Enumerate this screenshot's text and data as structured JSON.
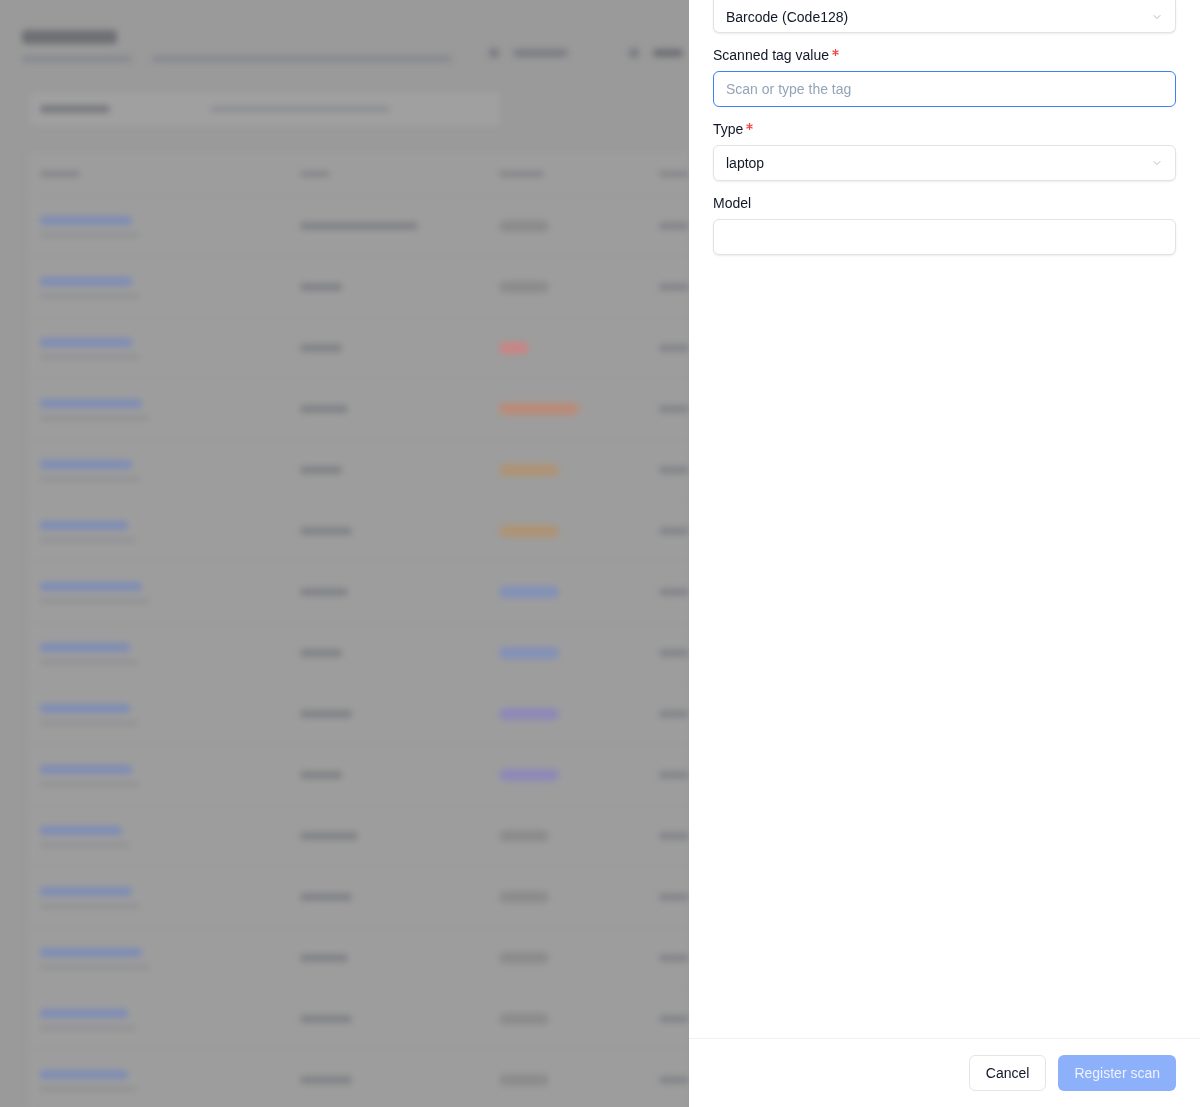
{
  "drawer": {
    "fields": [
      {
        "kind": "select",
        "value": "Barcode (Code128)"
      },
      {
        "kind": "input",
        "label": "Scanned tag value",
        "required": true,
        "placeholder": "Scan or type the tag",
        "focused": true
      },
      {
        "kind": "select",
        "label": "Type",
        "required": true,
        "value": "laptop"
      },
      {
        "kind": "input",
        "label": "Model",
        "required": false,
        "focused": false
      }
    ],
    "buttons": [
      {
        "kind": "secondary",
        "label": "Cancel",
        "disabled": false
      },
      {
        "kind": "primary",
        "label": "Register scan",
        "disabled": true
      }
    ]
  }
}
